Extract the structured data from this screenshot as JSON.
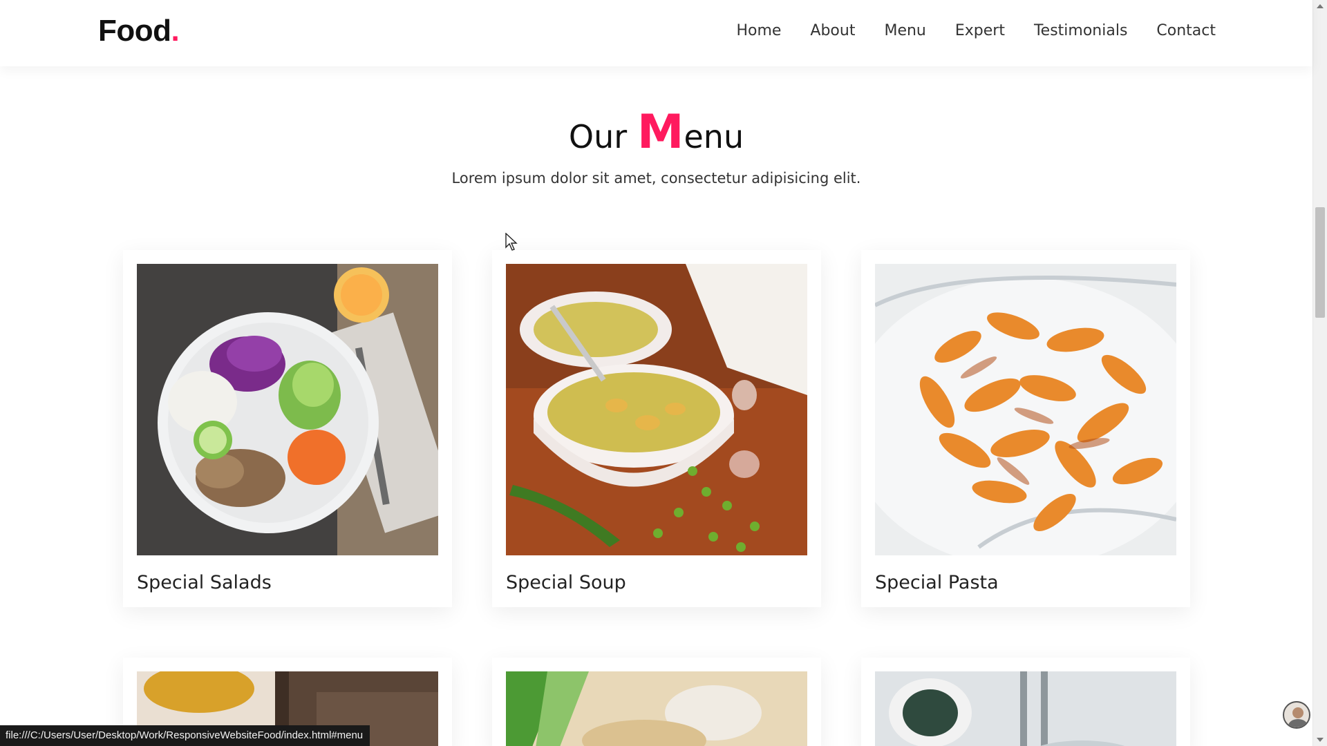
{
  "header": {
    "logo_text": "Food",
    "logo_dot": ".",
    "nav": [
      "Home",
      "About",
      "Menu",
      "Expert",
      "Testimonials",
      "Contact"
    ]
  },
  "menu_section": {
    "title_prefix": "Our ",
    "title_accent": "M",
    "title_suffix": "enu",
    "subtitle": "Lorem ipsum dolor sit amet, consectetur adipisicing elit.",
    "items": [
      {
        "name": "Special Salads"
      },
      {
        "name": "Special Soup"
      },
      {
        "name": "Special Pasta"
      }
    ]
  },
  "status_bar": {
    "url": "file:///C:/Users/User/Desktop/Work/ResponsiveWebsiteFood/index.html#menu"
  },
  "colors": {
    "accent": "#ff1a5e",
    "text": "#222222",
    "background": "#ffffff"
  }
}
